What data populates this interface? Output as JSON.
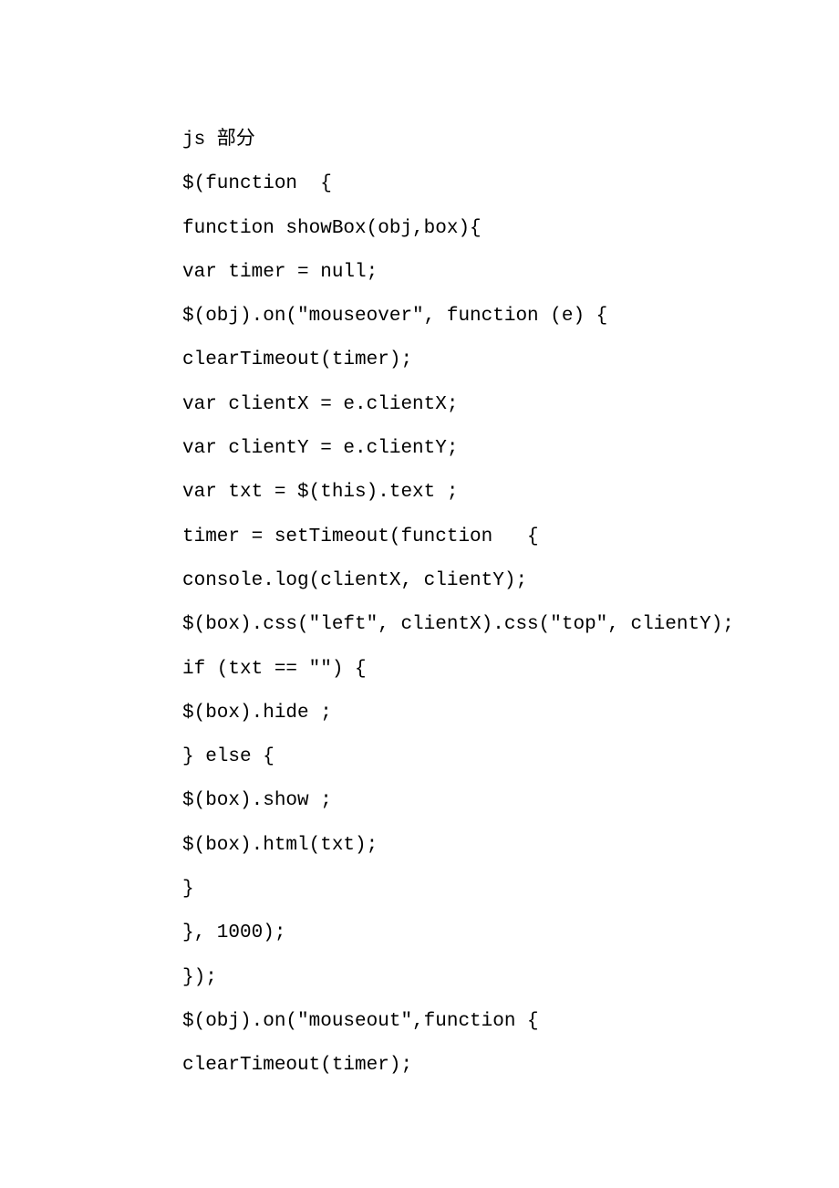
{
  "lines": [
    "js 部分",
    "$(function  {",
    "function showBox(obj,box){",
    "var timer = null;",
    "$(obj).on(\"mouseover\", function (e) {",
    "clearTimeout(timer);",
    "var clientX = e.clientX;",
    "var clientY = e.clientY;",
    "var txt = $(this).text ;",
    "timer = setTimeout(function   {",
    "console.log(clientX, clientY);",
    "$(box).css(\"left\", clientX).css(\"top\", clientY);",
    "if (txt == \"\") {",
    "$(box).hide ;",
    "} else {",
    "$(box).show ;",
    "$(box).html(txt);",
    "}",
    "}, 1000);",
    "});",
    "$(obj).on(\"mouseout\",function {",
    "clearTimeout(timer);"
  ]
}
